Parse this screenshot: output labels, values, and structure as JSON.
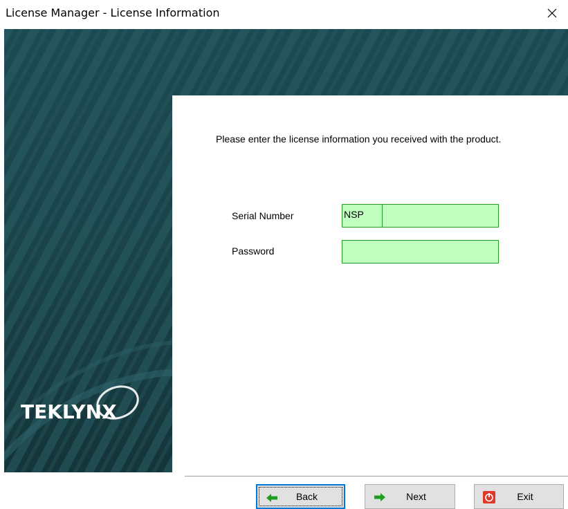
{
  "window": {
    "title": "License Manager - License Information",
    "close_glyph": "✕"
  },
  "banner": {
    "brand": "TEKLYNX",
    "colors": {
      "dark": "#15393f",
      "mid": "#1f4d55",
      "stripe": "#2c6068"
    }
  },
  "form": {
    "instruction": "Please enter the license information you received with the product.",
    "serial_label": "Serial Number",
    "serial_prefix": "NSP",
    "serial_value": "",
    "password_label": "Password",
    "password_value": "",
    "field_color": "#c0ffc0"
  },
  "buttons": {
    "back": {
      "label": "Back",
      "icon": "green-left-arrow-icon"
    },
    "next": {
      "label": "Next",
      "icon": "green-right-arrow-icon"
    },
    "exit": {
      "label": "Exit",
      "icon": "red-power-icon"
    }
  }
}
